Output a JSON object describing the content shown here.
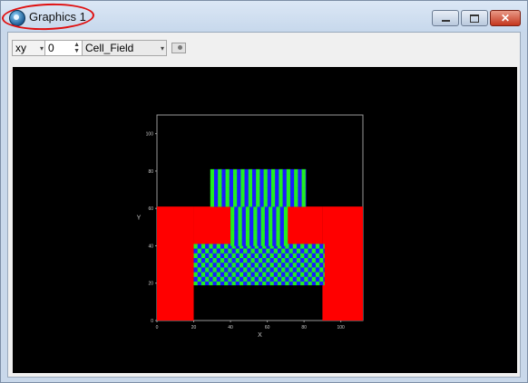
{
  "window": {
    "title": "Graphics 1",
    "minimize_icon": "minimize-icon",
    "maximize_icon": "maximize-icon",
    "close_label": "✕"
  },
  "toolbar": {
    "plane_value": "xy",
    "slice_value": "0",
    "field_value": "Cell_Field",
    "screenshot_icon": "camera-icon"
  },
  "chart_data": {
    "type": "heatmap",
    "xlabel": "X",
    "ylabel": "Y",
    "xlim": [
      0,
      112
    ],
    "ylim": [
      0,
      110
    ],
    "x_ticks": [
      "0",
      "20",
      "40",
      "60",
      "80",
      "100"
    ],
    "y_ticks": [
      "0",
      "20",
      "40",
      "60",
      "80",
      "100"
    ],
    "colors": {
      "red": "#ff0000",
      "green": "#22ee22",
      "blue": "#1c1cff",
      "black": "#000000"
    },
    "regions": [
      {
        "name": "left wall",
        "color": "red",
        "x": [
          0,
          20
        ],
        "y": [
          0,
          61
        ]
      },
      {
        "name": "right wall",
        "color": "red",
        "x": [
          90,
          112
        ],
        "y": [
          0,
          61
        ]
      },
      {
        "name": "upper left shelf",
        "color": "red",
        "x": [
          20,
          40
        ],
        "y": [
          40,
          61
        ]
      },
      {
        "name": "upper right shelf",
        "color": "red",
        "x": [
          71,
          90
        ],
        "y": [
          40,
          61
        ]
      },
      {
        "name": "lower cell block",
        "colors": [
          "green",
          "blue"
        ],
        "x": [
          20,
          91
        ],
        "y": [
          19,
          41
        ]
      },
      {
        "name": "middle cell column",
        "colors": [
          "green",
          "blue"
        ],
        "x": [
          40,
          71
        ],
        "y": [
          40,
          61
        ]
      },
      {
        "name": "upper cell block",
        "colors": [
          "green",
          "blue"
        ],
        "x": [
          29,
          81
        ],
        "y": [
          61,
          81
        ]
      }
    ]
  }
}
